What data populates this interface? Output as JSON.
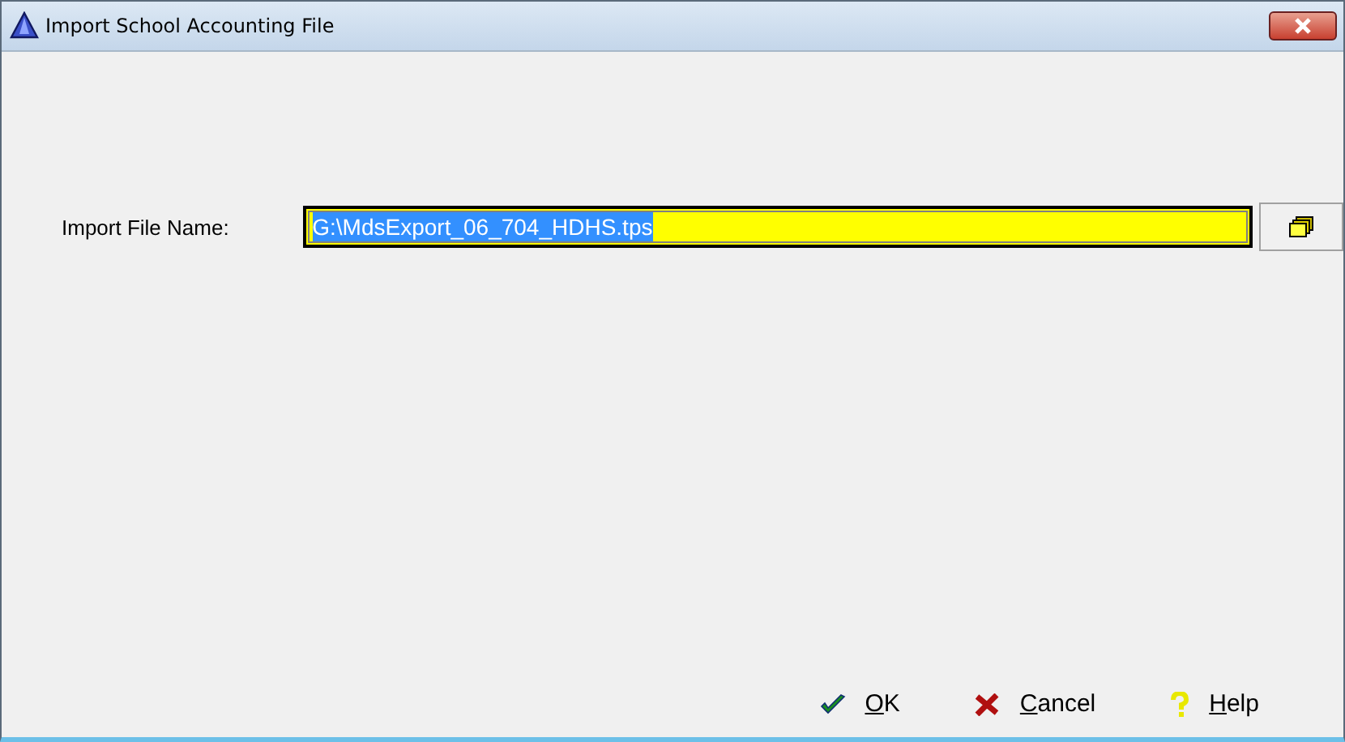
{
  "window": {
    "title": "Import School Accounting File"
  },
  "import_file": {
    "label": "Import File Name:",
    "value": "G:\\MdsExport_06_704_HDHS.tps",
    "text_selected": true
  },
  "buttons": [
    {
      "kind": "ok",
      "label": "OK",
      "mnemonic_underlined": true
    },
    {
      "kind": "cancel",
      "label": "Cancel",
      "mnemonic_underlined": true
    },
    {
      "kind": "help",
      "label": "Help",
      "mnemonic_underlined": true
    }
  ]
}
